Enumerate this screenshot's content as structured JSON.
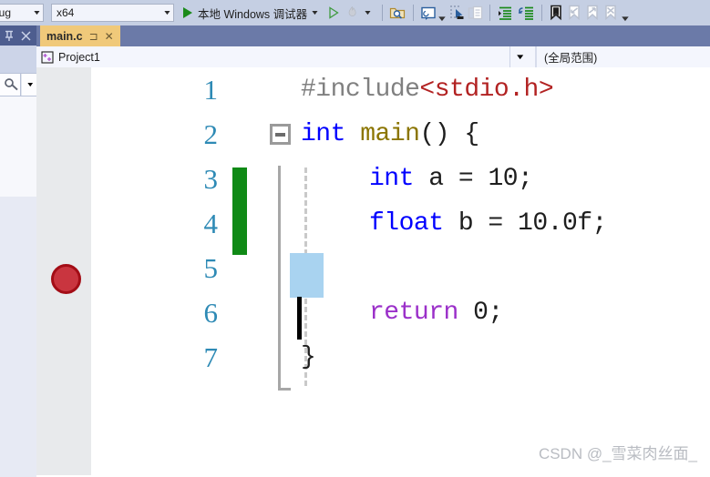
{
  "toolbar": {
    "config_combo": {
      "value": "bug",
      "icon": "chevron-down-icon"
    },
    "platform_combo": {
      "value": "x64",
      "icon": "chevron-down-icon"
    },
    "debug_button_label": "本地 Windows 调试器",
    "icons": [
      "start-debug-play-icon",
      "chevron-down-icon",
      "attach-process-play-icon",
      "hot-reload-flame-icon",
      "chevron-down-icon",
      "find-in-folder-icon",
      "comment-box-icon",
      "chevron-down-icon",
      "select-cursor-icon",
      "copy-lines-icon",
      "increase-indent-icon",
      "decrease-indent-icon",
      "toggle-bookmark-icon",
      "previous-bookmark-icon",
      "next-bookmark-icon",
      "clear-bookmarks-icon",
      "overflow-chevron-icon"
    ]
  },
  "left_dock": {
    "pin_icon": "pin-icon",
    "close_icon": "close-icon",
    "search_icon": "key-search-icon",
    "search_dropdown_icon": "chevron-down-icon"
  },
  "tab": {
    "label": "main.c",
    "pin_icon": "pin-icon",
    "close_icon": "close-icon"
  },
  "navbar": {
    "project": "Project1",
    "project_icon": "project-add-icon",
    "dropdown_icon": "chevron-down-icon",
    "scope": "(全局范围)"
  },
  "editor": {
    "lines": [
      {
        "number": "1",
        "indent": 0,
        "tokens": [
          {
            "text": "#include",
            "class": "k-pre"
          },
          {
            "text": "<stdio.h>",
            "class": "k-str"
          }
        ]
      },
      {
        "number": "2",
        "indent": 0,
        "tokens": [
          {
            "text": "int",
            "class": "k-kw"
          },
          {
            "text": " ",
            "class": "k-plain"
          },
          {
            "text": "main",
            "class": "k-fn"
          },
          {
            "text": "() {",
            "class": "k-plain"
          }
        ]
      },
      {
        "number": "3",
        "indent": 1,
        "tokens": [
          {
            "text": "int",
            "class": "k-kw"
          },
          {
            "text": " a = ",
            "class": "k-plain"
          },
          {
            "text": "10",
            "class": "k-num"
          },
          {
            "text": ";",
            "class": "k-plain"
          }
        ]
      },
      {
        "number": "4",
        "indent": 1,
        "tokens": [
          {
            "text": "float",
            "class": "k-kw"
          },
          {
            "text": " b = ",
            "class": "k-plain"
          },
          {
            "text": "10.0f",
            "class": "k-num"
          },
          {
            "text": ";",
            "class": "k-plain"
          }
        ]
      },
      {
        "number": "5",
        "indent": 1,
        "tokens": []
      },
      {
        "number": "6",
        "indent": 1,
        "tokens": [
          {
            "text": "return",
            "class": "k-ret"
          },
          {
            "text": " ",
            "class": "k-plain"
          },
          {
            "text": "0",
            "class": "k-num"
          },
          {
            "text": ";",
            "class": "k-plain"
          }
        ]
      },
      {
        "number": "7",
        "indent": 0,
        "tokens": [
          {
            "text": "}",
            "class": "k-plain"
          }
        ]
      }
    ],
    "breakpoint_line": 5,
    "cursor_line": 6,
    "selected_line": 5,
    "changed_lines": [
      3,
      4
    ],
    "collapse_line": 2
  },
  "watermark": {
    "text": "CSDN @_雪菜肉丝面_"
  },
  "colors": {
    "toolbar_bg": "#c5cfe3",
    "tabstrip_bg": "#6b7aa8",
    "active_tab": "#f0c97a",
    "line_number": "#2e8ab5",
    "breakpoint": "#c9353f",
    "change_bar": "#108a16",
    "selection": "#a9d3f0",
    "keyword": "#0000ff",
    "string": "#b22222",
    "preproc": "#808080",
    "function": "#8b7500",
    "control": "#9b30c9"
  }
}
